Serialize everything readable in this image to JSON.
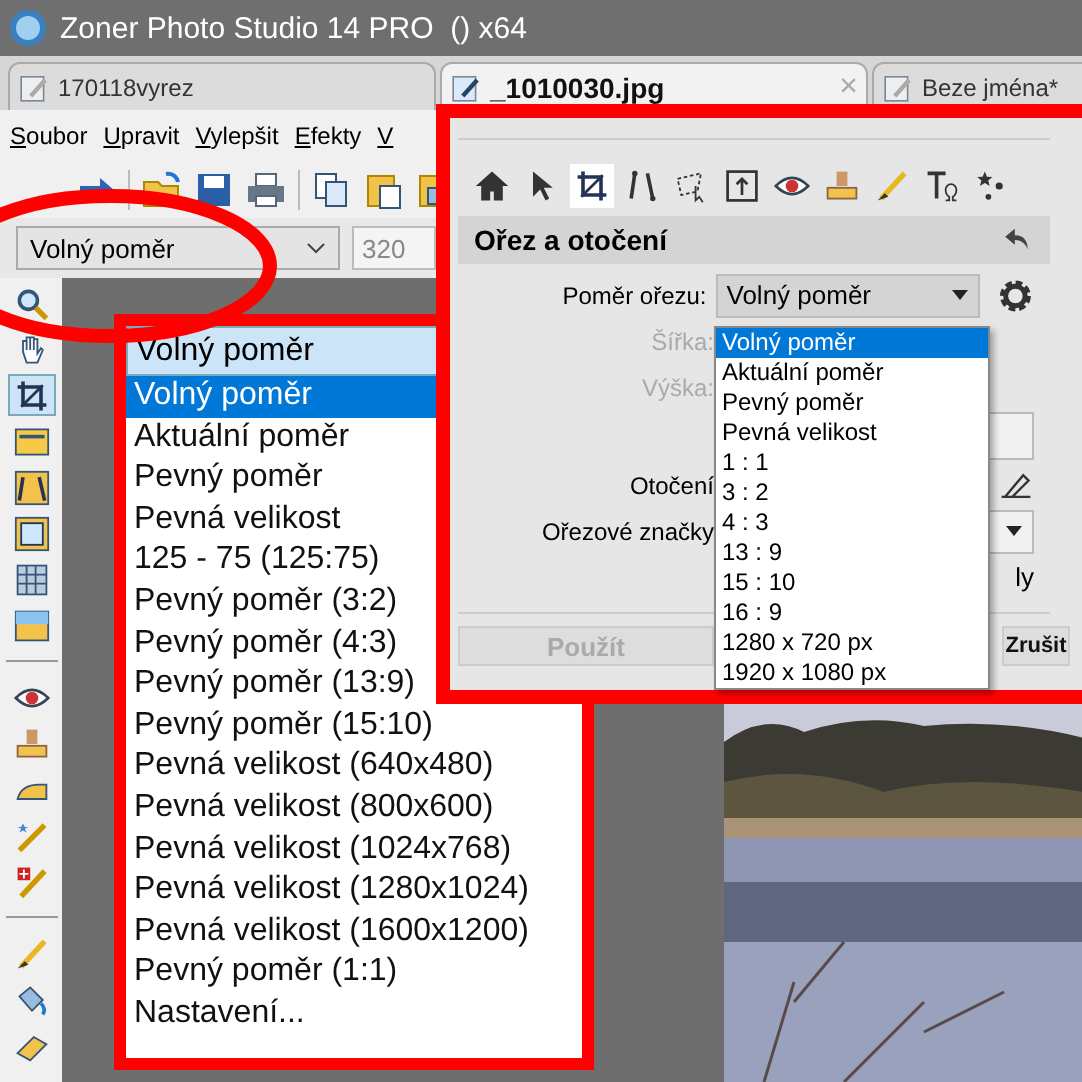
{
  "window": {
    "title": "Zoner Photo Studio 14 PRO  () x64"
  },
  "tabs": [
    {
      "label": "170118vyrez",
      "selected": false
    },
    {
      "label": "_1010030.jpg",
      "selected": true,
      "close": "×"
    },
    {
      "label": "Beze jména*",
      "selected": false
    }
  ],
  "menu": [
    "Soubor",
    "Upravit",
    "Vylepšit",
    "Efekty",
    "V"
  ],
  "crop_combo": {
    "value": "Volný poměr"
  },
  "size_field": {
    "value": "320"
  },
  "left_tools": [
    {
      "kind": "zoom",
      "selected": false
    },
    {
      "kind": "hand",
      "selected": false
    },
    {
      "kind": "crop",
      "selected": true
    },
    {
      "kind": "level",
      "selected": false
    },
    {
      "kind": "perspective",
      "selected": false
    },
    {
      "kind": "frame",
      "selected": false
    },
    {
      "kind": "grid",
      "selected": false
    },
    {
      "kind": "gradient",
      "selected": false
    },
    {
      "kind": "separator"
    },
    {
      "kind": "eye",
      "selected": false
    },
    {
      "kind": "stamp",
      "selected": false
    },
    {
      "kind": "iron",
      "selected": false
    },
    {
      "kind": "wand",
      "selected": false
    },
    {
      "kind": "heal",
      "selected": false
    },
    {
      "kind": "separator"
    },
    {
      "kind": "brush",
      "selected": false
    },
    {
      "kind": "bucket",
      "selected": false
    },
    {
      "kind": "eraser",
      "selected": false
    }
  ],
  "ratio_list": {
    "header": "Volný poměr",
    "items": [
      {
        "label": "Volný poměr",
        "selected": true
      },
      {
        "label": "Aktuální poměr",
        "selected": false
      },
      {
        "label": "Pevný poměr",
        "selected": false
      },
      {
        "label": "Pevná velikost",
        "selected": false
      },
      {
        "label": "125 - 75 (125:75)",
        "selected": false
      },
      {
        "label": "Pevný poměr (3:2)",
        "selected": false
      },
      {
        "label": "Pevný poměr (4:3)",
        "selected": false
      },
      {
        "label": "Pevný poměr (13:9)",
        "selected": false
      },
      {
        "label": "Pevný poměr (15:10)",
        "selected": false
      },
      {
        "label": "Pevná velikost (640x480)",
        "selected": false
      },
      {
        "label": "Pevná velikost (800x600)",
        "selected": false
      },
      {
        "label": "Pevná velikost (1024x768)",
        "selected": false
      },
      {
        "label": "Pevná velikost (1280x1024)",
        "selected": false
      },
      {
        "label": "Pevná velikost (1600x1200)",
        "selected": false
      },
      {
        "label": "Pevný poměr (1:1)",
        "selected": false
      },
      {
        "label": "Nastavení...",
        "selected": false
      }
    ]
  },
  "panel": {
    "tools": [
      {
        "kind": "home",
        "selected": false
      },
      {
        "kind": "pointer",
        "selected": false
      },
      {
        "kind": "crop",
        "selected": true
      },
      {
        "kind": "straighten",
        "selected": false
      },
      {
        "kind": "lasso",
        "selected": false
      },
      {
        "kind": "export",
        "selected": false
      },
      {
        "kind": "eye",
        "selected": false
      },
      {
        "kind": "stamp",
        "selected": false
      },
      {
        "kind": "brush",
        "selected": false
      },
      {
        "kind": "text",
        "selected": false
      },
      {
        "kind": "stars",
        "selected": false
      }
    ],
    "title": "Ořez a otočení",
    "ratio_label": "Poměr ořezu:",
    "ratio_value": "Volný poměr",
    "width_label": "Šířka:",
    "height_label": "Výška:",
    "rotation_label": "Otočení",
    "marks_label": "Ořezové značky",
    "fragment": "ly",
    "apply": {
      "label": "Použít",
      "disabled": true
    },
    "cancel": {
      "label": "Zrušit",
      "disabled": false
    },
    "options": [
      {
        "label": "Volný poměr",
        "selected": true
      },
      {
        "label": "Aktuální poměr",
        "selected": false
      },
      {
        "label": "Pevný poměr",
        "selected": false
      },
      {
        "label": "Pevná velikost",
        "selected": false
      },
      {
        "label": "1 : 1",
        "selected": false
      },
      {
        "label": "3 : 2",
        "selected": false
      },
      {
        "label": "4 : 3",
        "selected": false
      },
      {
        "label": "13 : 9",
        "selected": false
      },
      {
        "label": "15 : 10",
        "selected": false
      },
      {
        "label": "16 : 9",
        "selected": false
      },
      {
        "label": "1280 x 720 px",
        "selected": false
      },
      {
        "label": "1920 x 1080 px",
        "selected": false
      }
    ]
  }
}
